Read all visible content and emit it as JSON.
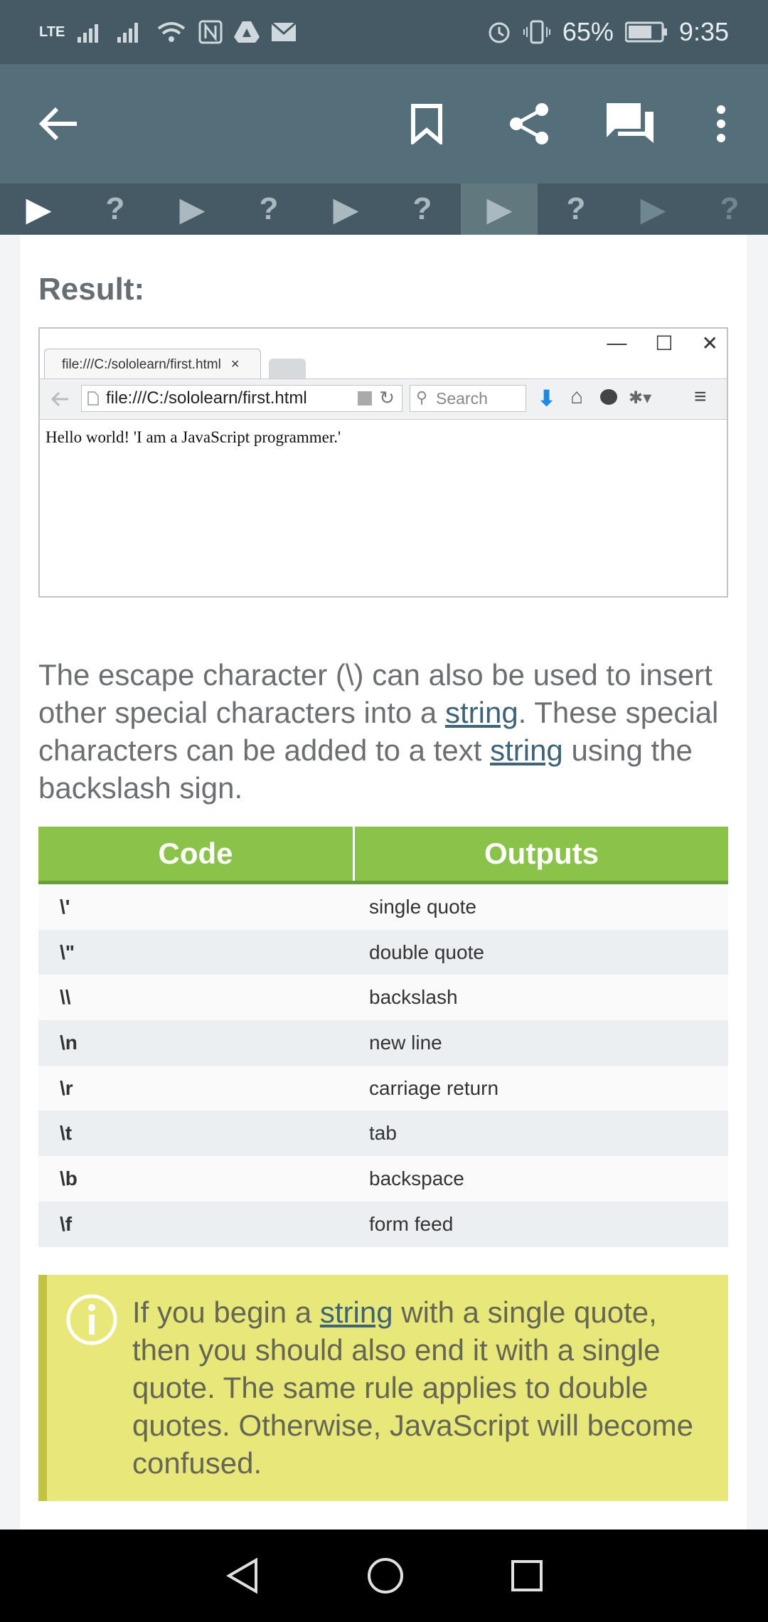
{
  "status_bar": {
    "network": "LTE",
    "battery": "65%",
    "time": "9:35"
  },
  "app_bar": {
    "icons": [
      "back-arrow-icon",
      "bookmark-icon",
      "share-icon",
      "comments-icon",
      "more-vert-icon"
    ]
  },
  "progress_tabs": [
    {
      "type": "play",
      "label": "▶"
    },
    {
      "type": "quiz",
      "label": "?"
    },
    {
      "type": "play",
      "label": "▶"
    },
    {
      "type": "quiz",
      "label": "?"
    },
    {
      "type": "play",
      "label": "▶"
    },
    {
      "type": "quiz",
      "label": "?"
    },
    {
      "type": "play",
      "label": "▶"
    },
    {
      "type": "quiz",
      "label": "?"
    },
    {
      "type": "play",
      "label": "▶"
    },
    {
      "type": "quiz",
      "label": "?"
    }
  ],
  "result": {
    "label": "Result:",
    "browser": {
      "tab_title": "file:///C:/sololearn/first.html",
      "tab_close": "×",
      "url": "file:///C:/sololearn/first.html",
      "search_placeholder": "Search",
      "page_output": "Hello world! 'I am a JavaScript programmer.'"
    }
  },
  "paragraph": {
    "part1": "The escape character (\\) can also be used to insert other special characters into a ",
    "link1": "string",
    "part2": ". These special characters can be added to a text ",
    "link2": "string",
    "part3": " using the backslash sign."
  },
  "table": {
    "headers": [
      "Code",
      "Outputs"
    ],
    "rows": [
      {
        "code": "\\'",
        "output": "single quote"
      },
      {
        "code": "\\\"",
        "output": "double quote"
      },
      {
        "code": "\\\\",
        "output": "backslash"
      },
      {
        "code": "\\n",
        "output": "new line"
      },
      {
        "code": "\\r",
        "output": "carriage return"
      },
      {
        "code": "\\t",
        "output": "tab"
      },
      {
        "code": "\\b",
        "output": "backspace"
      },
      {
        "code": "\\f",
        "output": "form feed"
      }
    ]
  },
  "note": {
    "part1": "If you begin a ",
    "link": "string",
    "part2": " with a single quote, then you should also end it with a single quote. The same rule applies to double quotes. Otherwise, JavaScript will become confused."
  },
  "colors": {
    "status_bar": "#455a64",
    "app_bar": "#546e7a",
    "table_header": "#8bc34a",
    "note_bg": "#e8e87a",
    "link": "#3f6478"
  }
}
